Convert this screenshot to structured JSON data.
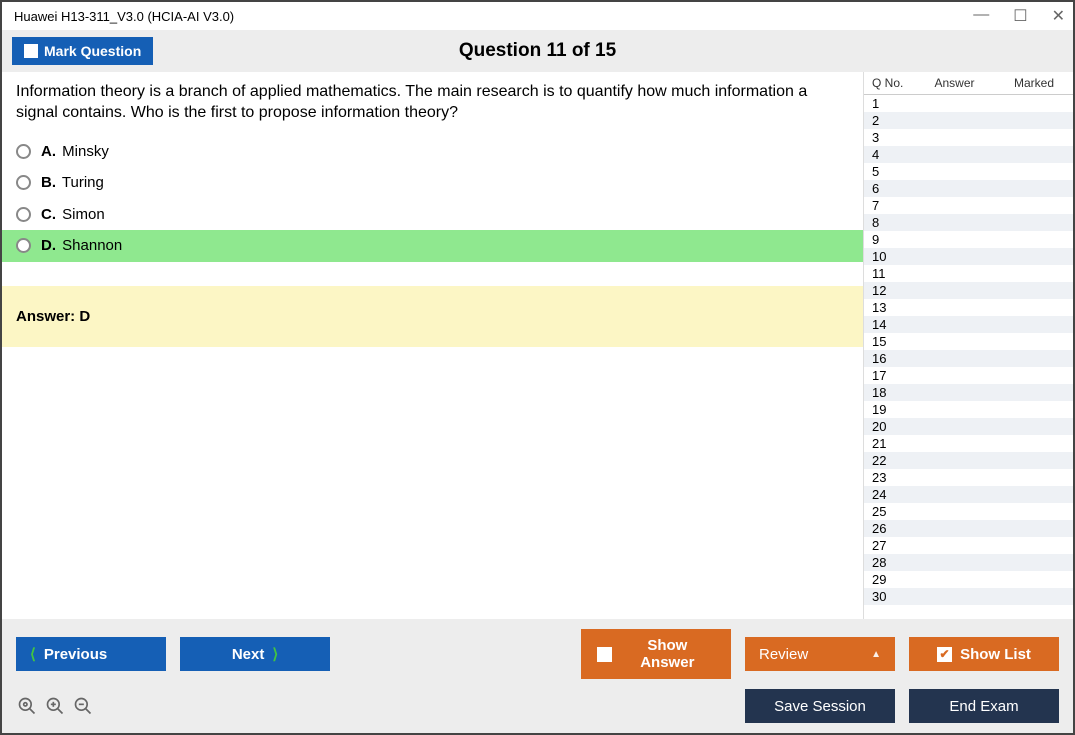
{
  "window": {
    "title": "Huawei H13-311_V3.0 (HCIA-AI V3.0)"
  },
  "header": {
    "mark_label": "Mark Question",
    "indicator": "Question 11 of 15"
  },
  "question": {
    "text": "Information theory is a branch of applied mathematics. The main research is to quantify how much information a signal contains. Who is the first to propose information theory?",
    "choices": [
      {
        "letter": "A.",
        "text": "Minsky",
        "correct": false
      },
      {
        "letter": "B.",
        "text": "Turing",
        "correct": false
      },
      {
        "letter": "C.",
        "text": "Simon",
        "correct": false
      },
      {
        "letter": "D.",
        "text": "Shannon",
        "correct": true
      }
    ],
    "answer_label": "Answer: D"
  },
  "sidebar": {
    "headers": {
      "qno": "Q No.",
      "answer": "Answer",
      "marked": "Marked"
    },
    "rows": [
      {
        "n": "1"
      },
      {
        "n": "2"
      },
      {
        "n": "3"
      },
      {
        "n": "4"
      },
      {
        "n": "5"
      },
      {
        "n": "6"
      },
      {
        "n": "7"
      },
      {
        "n": "8"
      },
      {
        "n": "9"
      },
      {
        "n": "10"
      },
      {
        "n": "11"
      },
      {
        "n": "12"
      },
      {
        "n": "13"
      },
      {
        "n": "14"
      },
      {
        "n": "15"
      },
      {
        "n": "16"
      },
      {
        "n": "17"
      },
      {
        "n": "18"
      },
      {
        "n": "19"
      },
      {
        "n": "20"
      },
      {
        "n": "21"
      },
      {
        "n": "22"
      },
      {
        "n": "23"
      },
      {
        "n": "24"
      },
      {
        "n": "25"
      },
      {
        "n": "26"
      },
      {
        "n": "27"
      },
      {
        "n": "28"
      },
      {
        "n": "29"
      },
      {
        "n": "30"
      }
    ]
  },
  "footer": {
    "previous": "Previous",
    "next": "Next",
    "show_answer": "Show Answer",
    "review": "Review",
    "show_list": "Show List",
    "save_session": "Save Session",
    "end_exam": "End Exam"
  }
}
